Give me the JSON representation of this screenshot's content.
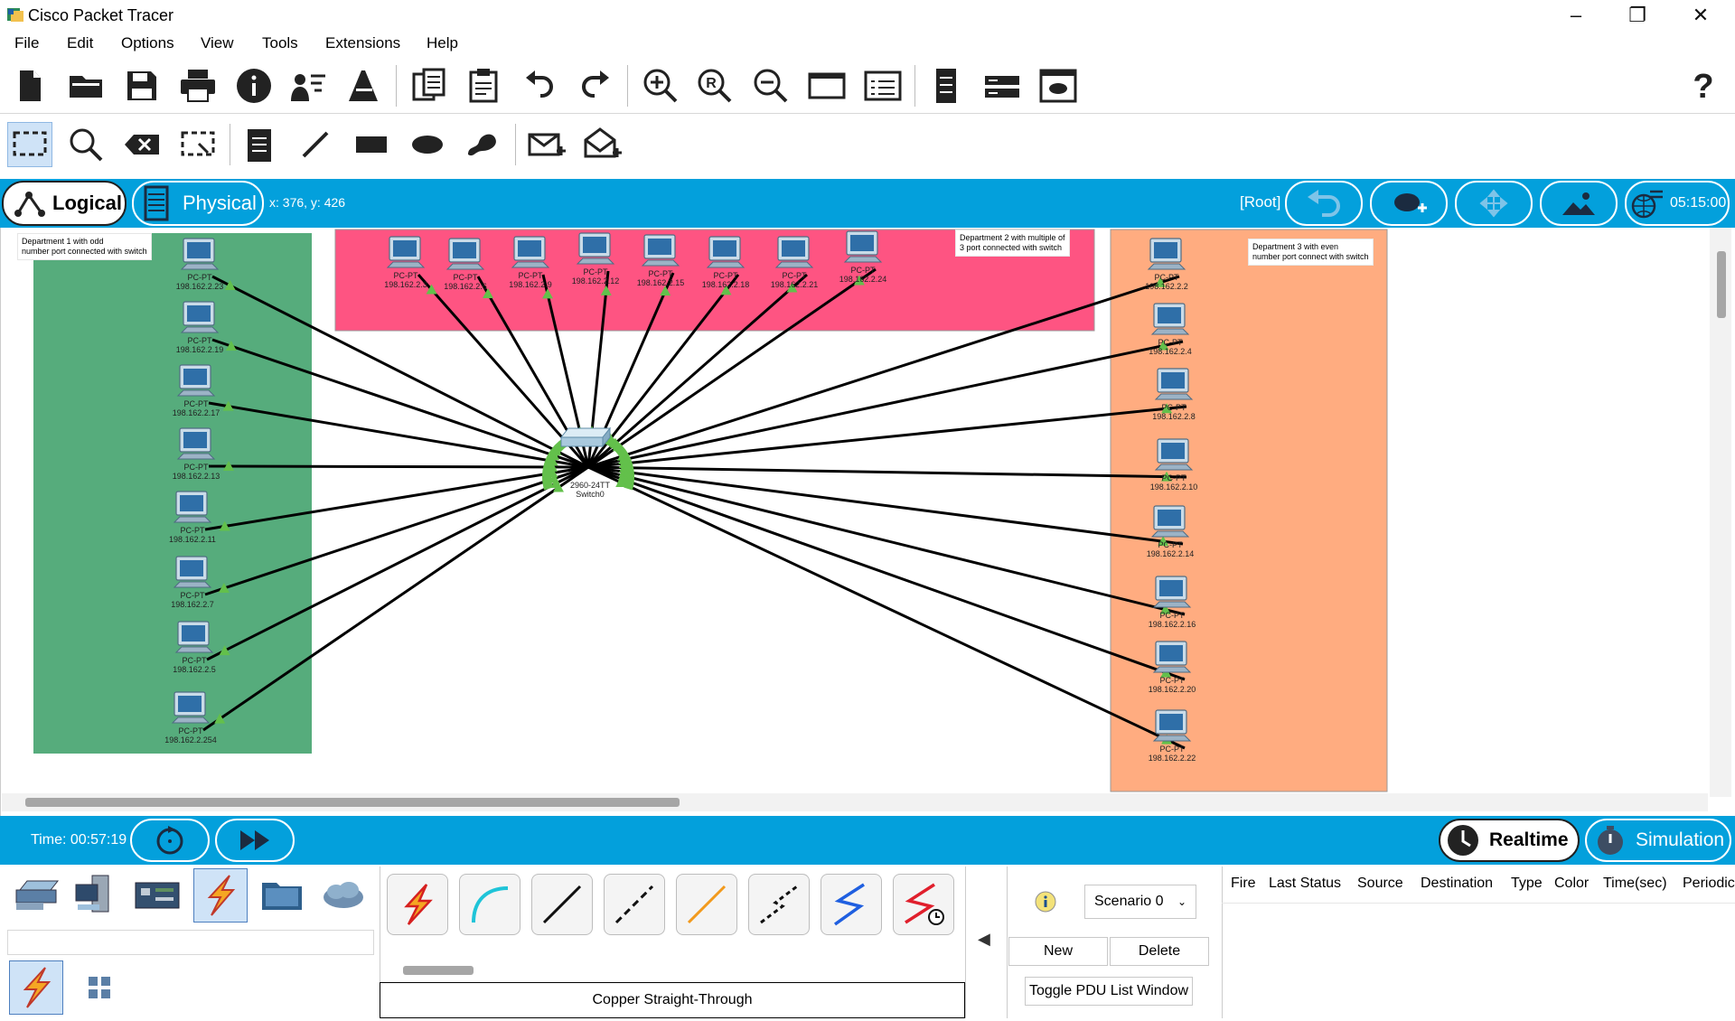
{
  "window": {
    "title": "Cisco Packet Tracer",
    "controls": [
      "minimize",
      "maximize",
      "close"
    ]
  },
  "menu": [
    "File",
    "Edit",
    "Options",
    "View",
    "Tools",
    "Extensions",
    "Help"
  ],
  "toolbar_main": [
    "new-file-icon",
    "open-folder-icon",
    "save-icon",
    "print-icon",
    "info-icon",
    "activity-wizard-icon",
    "custom-device-icon",
    "copy-icon",
    "paste-icon",
    "undo-icon",
    "redo-icon",
    "zoom-in-icon",
    "zoom-reset-icon",
    "zoom-out-icon",
    "drawing-palette-icon",
    "custom-devices-dialog-icon",
    "viewport-icon",
    "network-info-icon",
    "screenshot-icon",
    "help-icon"
  ],
  "toolbar_tools": [
    "select-icon",
    "inspect-icon",
    "delete-icon",
    "resize-shape-icon",
    "place-note-icon",
    "draw-line-icon",
    "draw-rectangle-icon",
    "draw-ellipse-icon",
    "draw-freeform-icon",
    "add-simple-pdu-icon",
    "add-complex-pdu-icon"
  ],
  "topbar": {
    "logical_label": "Logical",
    "physical_label": "Physical",
    "coords": "x: 376, y: 426",
    "root_label": "[Root]",
    "clock": "05:15:00"
  },
  "colors": {
    "accent_blue": "#03a0dc",
    "dept1": "#56ac7c",
    "dept2": "#fe5482",
    "dept3": "#ffac80",
    "link_up": "#63c04b"
  },
  "canvas": {
    "notes": {
      "dept1": [
        "Department 1 with odd",
        "number port connected with switch"
      ],
      "dept2": [
        "Department 2 with multiple of",
        "3 port connected with switch"
      ],
      "dept3": [
        "Department 3 with even",
        "number port connect with switch"
      ]
    },
    "switch": {
      "model": "2960-24TT",
      "name": "Switch0"
    },
    "dept1_pcs": [
      {
        "type": "PC-PT",
        "ip": "198.162.2.23"
      },
      {
        "type": "PC-PT",
        "ip": "198.162.2.19"
      },
      {
        "type": "PC-PT",
        "ip": "198.162.2.17"
      },
      {
        "type": "PC-PT",
        "ip": "198.162.2.13"
      },
      {
        "type": "PC-PT",
        "ip": "198.162.2.11"
      },
      {
        "type": "PC-PT",
        "ip": "198.162.2.7"
      },
      {
        "type": "PC-PT",
        "ip": "198.162.2.5"
      },
      {
        "type": "PC-PT",
        "ip": "198.162.2.254"
      }
    ],
    "dept2_pcs": [
      {
        "type": "PC-PT",
        "ip": "198.162.2.3"
      },
      {
        "type": "PC-PT",
        "ip": "198.162.2.6"
      },
      {
        "type": "PC-PT",
        "ip": "198.162.2.9"
      },
      {
        "type": "PC-PT",
        "ip": "198.162.2.12"
      },
      {
        "type": "PC-PT",
        "ip": "198.162.2.15"
      },
      {
        "type": "PC-PT",
        "ip": "198.162.2.18"
      },
      {
        "type": "PC-PT",
        "ip": "198.162.2.21"
      },
      {
        "type": "PC-PT",
        "ip": "198.162.2.24"
      }
    ],
    "dept3_pcs": [
      {
        "type": "PC-PT",
        "ip": "198.162.2.2"
      },
      {
        "type": "PC-PT",
        "ip": "198.162.2.4"
      },
      {
        "type": "PC-PT",
        "ip": "198.162.2.8"
      },
      {
        "type": "PC-PT",
        "ip": "198.162.2.10"
      },
      {
        "type": "PC-PT",
        "ip": "198.162.2.14"
      },
      {
        "type": "PC-PT",
        "ip": "198.162.2.16"
      },
      {
        "type": "PC-PT",
        "ip": "198.162.2.20"
      },
      {
        "type": "PC-PT",
        "ip": "198.162.2.22"
      }
    ]
  },
  "bottombar": {
    "time": "Time: 00:57:19",
    "realtime": "Realtime",
    "simulation": "Simulation"
  },
  "bottom": {
    "device_categories": [
      "network-devices-icon",
      "end-devices-icon",
      "components-icon",
      "connections-icon",
      "miscellaneous-icon",
      "multiuser-icon"
    ],
    "connection_types": [
      "automatic-connection-icon",
      "console-cable-icon",
      "copper-straight-through-icon",
      "copper-cross-over-icon",
      "fiber-icon",
      "phone-cable-icon",
      "coaxial-icon",
      "serial-dce-icon"
    ],
    "selected_connection": "Copper Straight-Through",
    "scenario": "Scenario 0",
    "new_label": "New",
    "delete_label": "Delete",
    "toggle_label": "Toggle PDU List Window",
    "pdu_columns": [
      "Fire",
      "Last Status",
      "Source",
      "Destination",
      "Type",
      "Color",
      "Time(sec)",
      "Periodic"
    ]
  }
}
